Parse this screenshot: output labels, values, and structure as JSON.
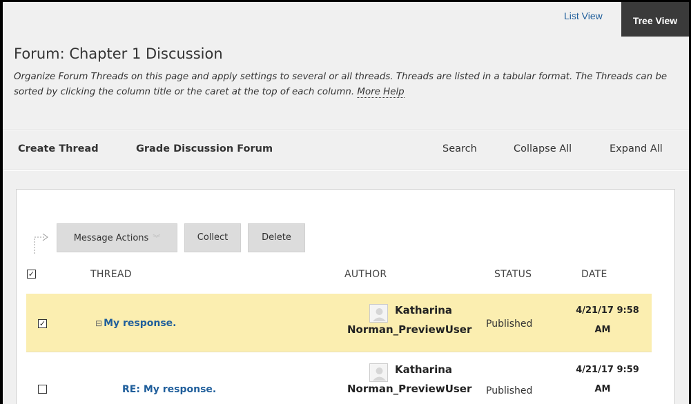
{
  "view_tabs": {
    "list_view": "List View",
    "tree_view": "Tree View"
  },
  "header": {
    "title": "Forum: Chapter 1 Discussion",
    "description": "Organize Forum Threads on this page and apply settings to several or all threads. Threads are listed in a tabular format. The Threads can be sorted by clicking the column title or the caret at the top of each column.",
    "more_help": "More Help"
  },
  "action_bar": {
    "create_thread": "Create Thread",
    "grade_forum": "Grade Discussion Forum",
    "search": "Search",
    "collapse_all": "Collapse All",
    "expand_all": "Expand All"
  },
  "toolbar": {
    "message_actions": "Message Actions",
    "collect": "Collect",
    "delete": "Delete"
  },
  "columns": {
    "thread": "THREAD",
    "author": "AUTHOR",
    "status": "STATUS",
    "date": "DATE"
  },
  "select_all_checked": true,
  "rows": [
    {
      "checked": true,
      "expander": "⊟",
      "thread": "My response.",
      "author_first": "Katharina",
      "author_last": "Norman_PreviewUser",
      "status": "Published",
      "date_line1": "4/21/17 9:58",
      "date_line2": "AM"
    },
    {
      "checked": false,
      "thread": "RE: My response.",
      "author_first": "Katharina",
      "author_last": "Norman_PreviewUser",
      "status": "Published",
      "date_line1": "4/21/17 9:59",
      "date_line2": "AM"
    }
  ],
  "colors": {
    "link": "#1f5e9b",
    "highlight_row": "#fbeeb0",
    "active_tab": "#3a3a3a"
  }
}
